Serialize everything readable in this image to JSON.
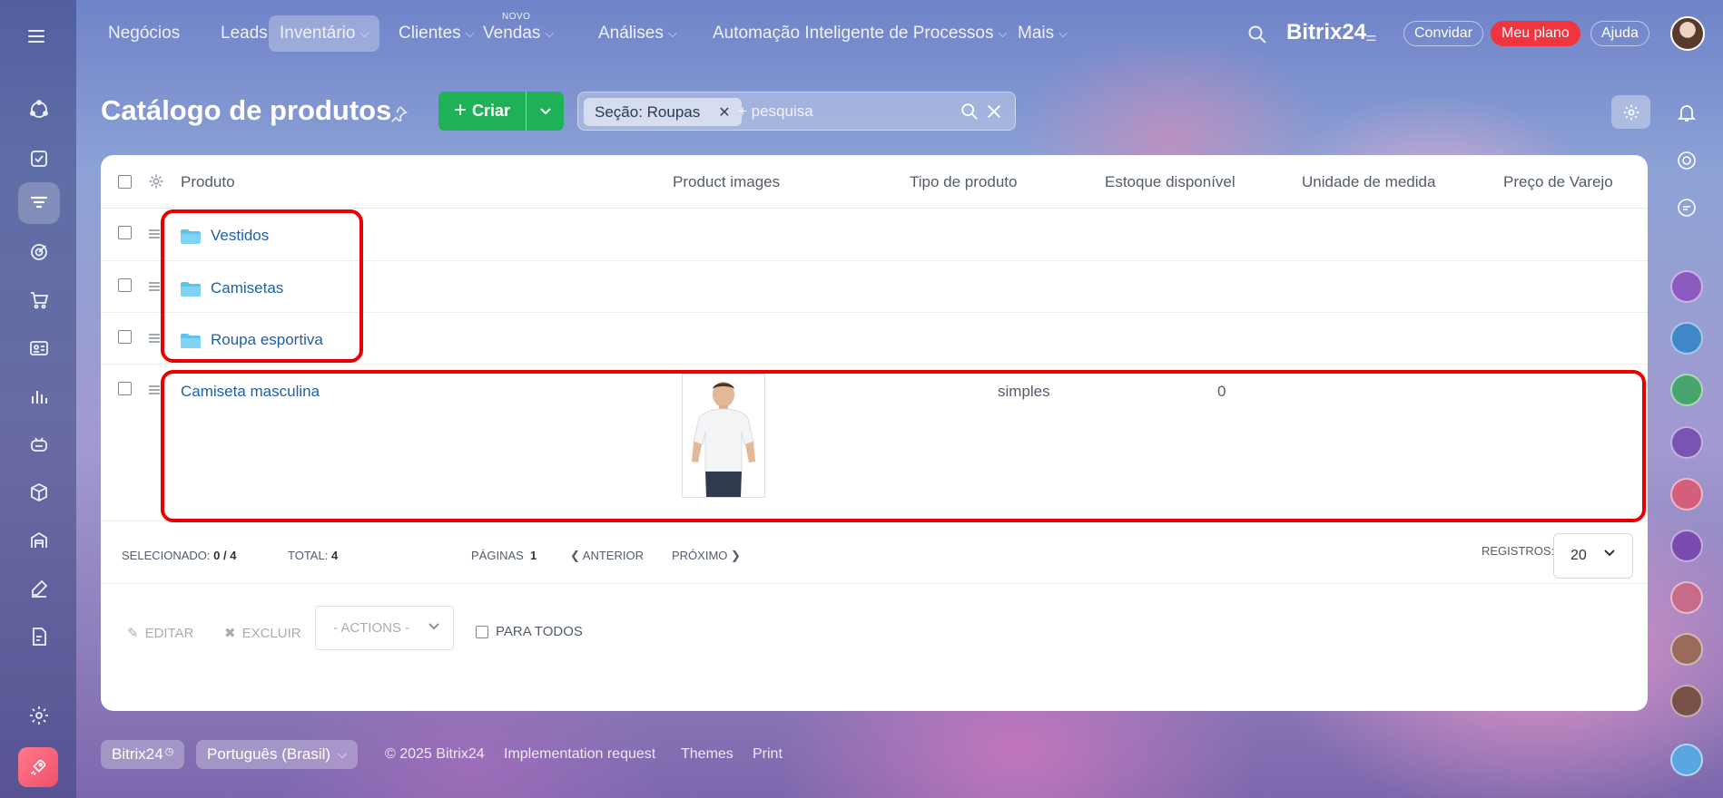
{
  "topnav": {
    "items": [
      {
        "label": "Negócios"
      },
      {
        "label": "Leads"
      },
      {
        "label": "Inventário",
        "active": true
      },
      {
        "label": "Clientes"
      },
      {
        "label": "Vendas",
        "badge": "NOVO"
      },
      {
        "label": "Análises"
      },
      {
        "label": "Automação Inteligente de Processos"
      },
      {
        "label": "Mais"
      }
    ],
    "brand": "Bitrix24",
    "invite_label": "Convidar",
    "plan_label": "Meu plano",
    "help_label": "Ajuda"
  },
  "header": {
    "title": "Catálogo de produtos",
    "create_label": "Criar",
    "filter_chip": "Seção: Roupas",
    "search_placeholder": "+ pesquisa"
  },
  "grid": {
    "columns": [
      "Produto",
      "Product images",
      "Tipo de produto",
      "Estoque disponível",
      "Unidade de medida",
      "Preço de Varejo"
    ],
    "folders": [
      {
        "name": "Vestidos"
      },
      {
        "name": "Camisetas"
      },
      {
        "name": "Roupa esportiva"
      }
    ],
    "products": [
      {
        "name": "Camiseta masculina",
        "type": "simples",
        "stock": "0"
      }
    ]
  },
  "footer": {
    "selected_label": "SELECIONADO:",
    "selected_value": "0 / 4",
    "total_label": "TOTAL:",
    "total_value": "4",
    "pages_label": "PÁGINAS",
    "pages_value": "1",
    "prev_label": "ANTERIOR",
    "next_label": "PRÓXIMO",
    "records_label": "REGISTROS:",
    "records_value": "20"
  },
  "actions": {
    "edit_label": "EDITAR",
    "delete_label": "EXCLUIR",
    "actions_select": "- ACTIONS -",
    "for_all_label": "PARA TODOS"
  },
  "bottom": {
    "bitrix_label": "Bitrix24",
    "language": "Português (Brasil)",
    "copyright": "© 2025 Bitrix24",
    "links": [
      "Implementation request",
      "Themes",
      "Print"
    ]
  },
  "colors": {
    "accent_green": "#1fb155",
    "plan_red": "#f0353f",
    "link_blue": "#1f5fa7",
    "highlight_red": "#e60000"
  }
}
